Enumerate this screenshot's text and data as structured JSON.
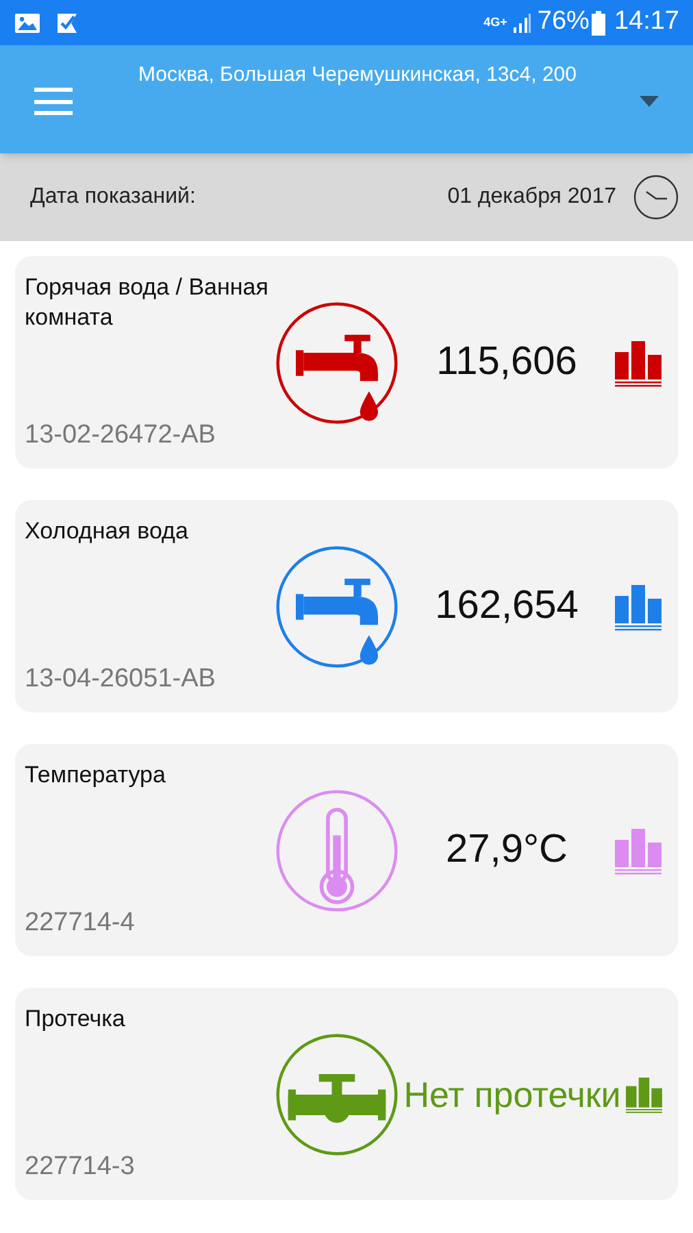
{
  "status_bar": {
    "network": "4G+",
    "battery": "76%",
    "time": "14:17"
  },
  "app_bar": {
    "address": "Москва, Большая Черемушкинская, 13с4, 200"
  },
  "date_bar": {
    "label": "Дата показаний:",
    "date": "01 декабря 2017"
  },
  "meters": [
    {
      "kind": "hot_water",
      "name": "Горячая вода / Ванная комната",
      "reading": "115,606",
      "serial": "13-02-26472-AB",
      "color": "#cc0000"
    },
    {
      "kind": "cold_water",
      "name": "Холодная вода",
      "reading": "162,654",
      "serial": "13-04-26051-AB",
      "color": "#1e7fe8"
    },
    {
      "kind": "temperature",
      "name": "Температура",
      "reading": "27,9°C",
      "serial": "227714-4",
      "color": "#dc8cf0"
    },
    {
      "kind": "leak",
      "name": "Протечка",
      "reading": "Нет протечки",
      "serial": "227714-3",
      "color": "#5e9a16"
    }
  ]
}
